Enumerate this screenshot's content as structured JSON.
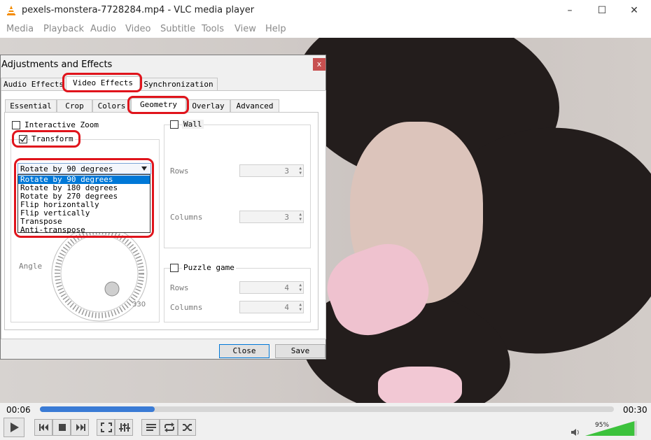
{
  "window": {
    "title": "pexels-monstera-7728284.mp4 - VLC media player"
  },
  "menu": [
    "Media",
    "Playback",
    "Audio",
    "Video",
    "Subtitle",
    "Tools",
    "View",
    "Help"
  ],
  "player": {
    "elapsed": "00:06",
    "total": "00:30",
    "progress": 0.2,
    "volume": "95%",
    "volume_level": 0.95
  },
  "dialog": {
    "title": "Adjustments and Effects",
    "close_glyph": "x",
    "tabs": [
      "Audio Effects",
      "Video Effects",
      "Synchronization"
    ],
    "subtabs": [
      "Essential",
      "Crop",
      "Colors",
      "Geometry",
      "Overlay",
      "Advanced"
    ],
    "interactive_zoom": "Interactive Zoom",
    "transform": "Transform",
    "transform_selected": "Rotate by 90 degrees",
    "transform_options": [
      "Rotate by 90 degrees",
      "Rotate by 180 degrees",
      "Rotate by 270 degrees",
      "Flip horizontally",
      "Flip vertically",
      "Transpose",
      "Anti-transpose"
    ],
    "angle_label": "Angle",
    "angle_value": "330",
    "wall": {
      "label": "Wall",
      "rows_label": "Rows",
      "rows_value": "3",
      "columns_label": "Columns",
      "columns_value": "3"
    },
    "puzzle": {
      "label": "Puzzle game",
      "rows_label": "Rows",
      "rows_value": "4",
      "columns_label": "Columns",
      "columns_value": "4"
    },
    "close_button": "Close",
    "save_button": "Save"
  },
  "colors": {
    "accent": "#0078d7",
    "highlight_ring": "#e0141c",
    "vlc_orange": "#f48b00",
    "volume_green": "#3cc23c"
  }
}
